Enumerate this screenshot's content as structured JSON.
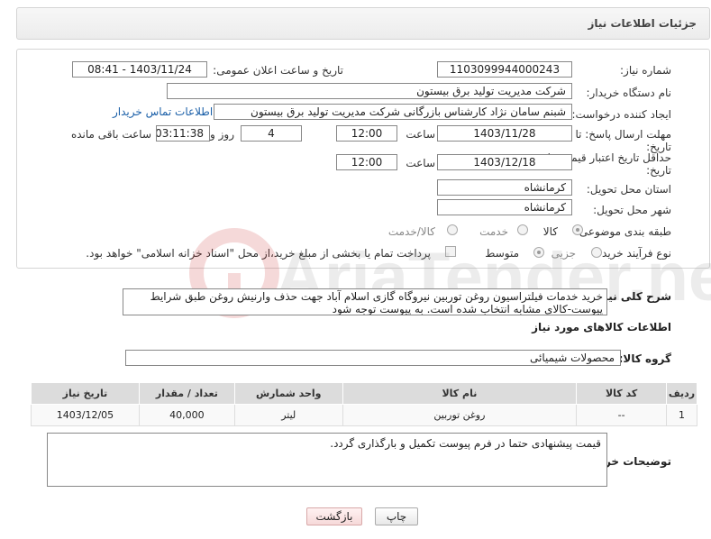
{
  "header": {
    "title": "جزئیات اطلاعات نیاز"
  },
  "form": {
    "need_number_label": "شماره نیاز:",
    "need_number": "1103099944000243",
    "announce_label": "تاریخ و ساعت اعلان عمومی:",
    "announce_value": "1403/11/24 - 08:41",
    "buyer_org_label": "نام دستگاه خریدار:",
    "buyer_org": "شرکت مدیریت تولید برق بیستون",
    "creator_label": "ایجاد کننده درخواست:",
    "creator": "شبنم سامان نژاد کارشناس بازرگانی شرکت مدیریت تولید برق بیستون",
    "contact_link": "اطلاعات تماس خریدار",
    "deadline_label_1": "مهلت ارسال پاسخ: تا",
    "deadline_label_2": "تاریخ:",
    "deadline_date": "1403/11/28",
    "time_label": "ساعت",
    "deadline_time": "12:00",
    "days_value": "4",
    "days_label": "روز و",
    "remaining_value": "03:11:38",
    "remaining_label": "ساعت باقی مانده",
    "validity_label_1": "حداقل تاریخ اعتبار قیمت: تا",
    "validity_label_2": "تاریخ:",
    "validity_date": "1403/12/18",
    "validity_time": "12:00",
    "province_label": "استان محل تحویل:",
    "province": "کرمانشاه",
    "city_label": "شهر محل تحویل:",
    "city": "کرمانشاه",
    "category_label": "طبقه بندی موضوعی:",
    "category_options": [
      "کالا",
      "خدمت",
      "کالا/خدمت"
    ],
    "category_selected": "کالا",
    "process_label": "نوع فرآیند خرید :",
    "process_options": [
      "جزیی",
      "متوسط"
    ],
    "process_selected": "متوسط",
    "payment_note": "پرداخت تمام یا بخشی از مبلغ خرید،از محل \"اسناد خزانه اسلامی\" خواهد بود."
  },
  "description": {
    "label": "شرح کلی نیاز:",
    "text": "خرید خدمات فیلتراسیون روغن توربین نیروگاه گازی اسلام آباد جهت حذف وارنیش روغن طبق شرایط پیوست-کالای مشابه انتخاب شده است. به پیوست توجه شود"
  },
  "goods_section": {
    "title": "اطلاعات کالاهای مورد نیاز",
    "group_label": "گروه کالا:",
    "group_value": "محصولات شیمیائی"
  },
  "table": {
    "headers": [
      "ردیف",
      "کد کالا",
      "نام کالا",
      "واحد شمارش",
      "تعداد / مقدار",
      "تاریخ نیاز"
    ],
    "rows": [
      [
        "1",
        "--",
        "روغن توربین",
        "لیتر",
        "40,000",
        "1403/12/05"
      ]
    ]
  },
  "notes": {
    "label": "توضیحات خریدار:",
    "text": "قیمت پیشنهادی حتما در فرم پیوست تکمیل و بارگذاری گردد."
  },
  "buttons": {
    "print": "چاپ",
    "back": "بازگشت"
  },
  "watermark": "AriaTender.neT"
}
